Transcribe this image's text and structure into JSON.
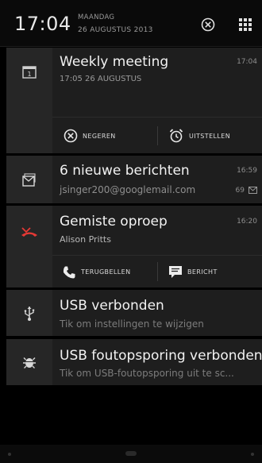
{
  "status": {
    "time": "17:04",
    "day": "MAANDAG",
    "date": "26 AUGUSTUS 2013"
  },
  "icons": {
    "clear": "clear-all-icon",
    "settings": "quick-settings-grid-icon"
  },
  "notifications": [
    {
      "icon": "calendar-icon",
      "title": "Weekly meeting",
      "subtitle": "17:05 26 AUGUSTUS",
      "time": "17:04",
      "actions": [
        {
          "icon": "dismiss-icon",
          "label": "NEGEREN"
        },
        {
          "icon": "alarm-clock-icon",
          "label": "UITSTELLEN"
        }
      ]
    },
    {
      "icon": "mail-icon",
      "title": "6 nieuwe berichten",
      "subtitle": "jsinger200@googlemail.com",
      "time": "16:59",
      "count": "69"
    },
    {
      "icon": "missed-call-icon",
      "title": "Gemiste oproep",
      "subtitle": "Alison Pritts",
      "time": "16:20",
      "actions": [
        {
          "icon": "phone-icon",
          "label": "TERUGBELLEN"
        },
        {
          "icon": "message-icon",
          "label": "BERICHT"
        }
      ]
    },
    {
      "icon": "usb-icon",
      "title": "USB verbonden",
      "subtitle": "Tik om instellingen te wijzigen"
    },
    {
      "icon": "android-debug-icon",
      "title": "USB foutopsporing verbonden",
      "subtitle": "Tik om USB-foutopsporing uit te sc..."
    }
  ],
  "colors": {
    "missed_call": "#e53935",
    "card_bg": "#1e1e1e",
    "icon_bg": "#262626"
  }
}
